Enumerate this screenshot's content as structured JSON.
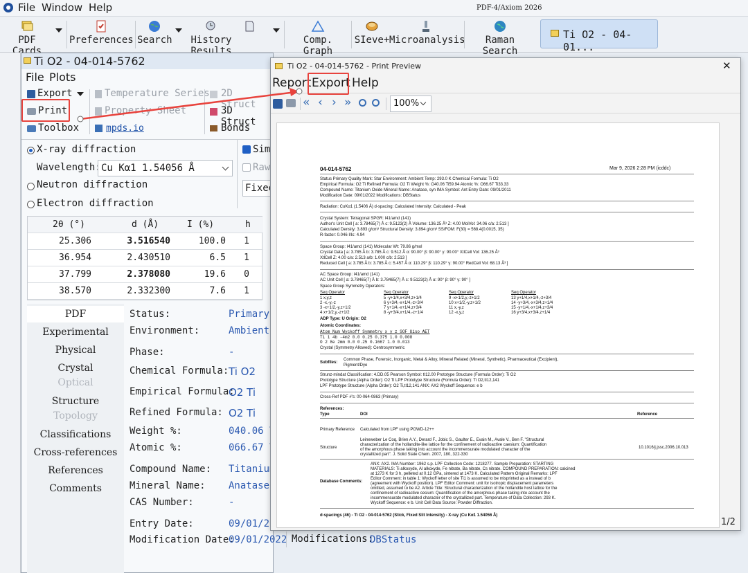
{
  "app": {
    "menu": [
      "File",
      "Window",
      "Help"
    ],
    "product_label": "PDF-4/Axiom 2026"
  },
  "toolbar": {
    "pdf_cards": "PDF Cards",
    "preferences": "Preferences",
    "search": "Search",
    "history_results": "History Results",
    "comp_graph": "Comp. Graph",
    "sieve": "SIeve+",
    "microanalysis": "Microanalysis",
    "raman_search": "Raman Search",
    "active_tab": "Ti O2 - 04-01..."
  },
  "card_window": {
    "title": "Ti O2 - 04-014-5762",
    "menu": [
      "File",
      "Plots"
    ],
    "tools": {
      "export": "Export",
      "print": "Print",
      "toolbox": "Toolbox",
      "temperature_series": "Temperature Series",
      "property_sheet": "Property Sheet",
      "mpds": "mpds.io",
      "structure_2d": "2D Struct",
      "structure_3d": "3D Struct",
      "bonds": "Bonds"
    },
    "diffraction": {
      "xray": "X-ray diffraction",
      "wavelength_label": "Wavelength:",
      "wavelength_value": "Cu Kα1 1.54056 Å",
      "neutron": "Neutron diffraction",
      "electron": "Electron diffraction",
      "sim_label": "Sim",
      "raw_label": "Raw",
      "fixed_label": "Fixed"
    },
    "peaks": {
      "headers": [
        "2θ (°)",
        "d (Å)",
        "I (%)",
        "h"
      ],
      "rows": [
        [
          "25.306",
          "3.516540",
          "100.0",
          "1"
        ],
        [
          "36.954",
          "2.430510",
          "6.5",
          "1"
        ],
        [
          "37.799",
          "2.378080",
          "19.6",
          "0"
        ],
        [
          "38.570",
          "2.332300",
          "7.6",
          "1"
        ]
      ]
    },
    "side_tabs": [
      "PDF",
      "Experimental",
      "Physical",
      "Crystal",
      "Optical",
      "Structure",
      "Topology",
      "Classifications",
      "Cross-references",
      "References",
      "Comments"
    ],
    "properties": [
      {
        "label": "Status:",
        "value": "Primary"
      },
      {
        "label": "Environment:",
        "value": "Ambient"
      },
      {
        "label": "Phase:",
        "value": "-"
      },
      {
        "label": "Chemical Formula:",
        "value": "Ti O2"
      },
      {
        "label": "Empirical Formula:",
        "value": "O2 Ti"
      },
      {
        "label": "Refined Formula:",
        "value": "O2 Ti"
      },
      {
        "label": "Weight %:",
        "value": "040.06 T"
      },
      {
        "label": "Atomic %:",
        "value": "066.67 T"
      },
      {
        "label": "Compound Name:",
        "value": "Titanium"
      },
      {
        "label": "Mineral Name:",
        "value": "Anatase,"
      },
      {
        "label": "CAS Number:",
        "value": "-"
      },
      {
        "label": "Entry Date:",
        "value": "09/01/20"
      },
      {
        "label": "Modification Date:",
        "value": "09/01/2022"
      }
    ],
    "modifications_label": "Modifications:",
    "modifications_value": "DBStatus"
  },
  "preview": {
    "title": "Ti O2 - 04-014-5762 - Print Preview",
    "menu": [
      "Report",
      "Export",
      "Help"
    ],
    "zoom": "100%",
    "page_indicator": "1/2"
  },
  "document": {
    "pdf_number": "04-014-5762",
    "date": "Mar 9, 2026 2:28 PM (icddc)",
    "header_lines": [
      "Status Primary    Quality Mark: Star    Environment: Ambient    Temp: 293.0 K    Chemical Formula: Ti O2",
      "Empirical Formula: O2 Ti    Refined Formula: O2 Ti    Weight %: O40.06 Ti59.94    Atomic %: O66.67 Ti33.33",
      "Compound Name: Titanium Oxide    Mineral Name: Anatase, syn    IMA Symbol: Ant    Entry Date: 09/01/2011",
      "Modification Date: 09/01/2022    Modifications: DBStatus"
    ],
    "radiation": "Radiation: CuKα1 (1.5406 Å)    d-spacing: Calculated    Intensity: Calculated - Peak",
    "crystal_lines": [
      "Crystal System: Tetragonal    SPGR: I41/amd (141)",
      "Author's Unit Cell [ a: 3.78465(7) Å    c: 9.5123(2) Å    Volume: 136.25 Å³    Z: 4.00    MolVol: 34.06    c/a: 2.513 ]",
      "Calculated Density: 3.893 g/cm³    Structural Density: 3.894 g/cm³    SS/FOM: F(30) = 568.4(0.0015, 35)",
      "R-factor: 0.046    I/Ic: 4.94"
    ],
    "space_group_lines": [
      "Space Group: I41/amd (141)    Molecular Wt: 79.86 g/mol",
      "Crystal Data [ a: 3.785 Å    b: 3.785 Å    c: 9.512 Å    α: 90.00°    β: 90.00°    γ: 90.00°    XtlCell Vol: 136.25 Å³",
      "XtlCell Z: 4.00    c/a: 2.513    a/b: 1.000    c/b: 2.513 ]",
      "Reduced Cell [ a: 3.785 Å    b: 3.785 Å    c: 5.457 Å    α: 110.29°    β: 110.29°    γ: 90.00°    RedCell Vol: 68.13 Å³ ]"
    ],
    "ac_lines": [
      "AC Space Group: I41/amd (141)",
      "AC Unit Cell [ a: 3.78465(7) Å    b: 3.78465(7) Å    c: 9.5123(2) Å    α: 90°    β: 90°    γ: 90° ]",
      "Space Group Symmetry Operators:"
    ],
    "sym_header": "Seq  Operator",
    "sym_ops": [
      [
        "1  x,y,z",
        "5  -y+1/4,x+3/4,z+1/4",
        "9  -x+1/2,y,-z+1/2",
        "13  y+1/4,x+1/4,-z+3/4"
      ],
      [
        "2  -x,-y,-z",
        "6  y+3/4,-x+1/4,-z+3/4",
        "10  x+1/2,-y,z+1/2",
        "14  -y+3/4,-x+3/4,z+1/4"
      ],
      [
        "3  -x+1/2,-y,z+1/2",
        "7  y+1/4,-x+1/4,z+3/4",
        "11  x,-y,z",
        "15  -y+1/4,-x+1/4,z+3/4"
      ],
      [
        "4  x+1/2,y,-z+1/2",
        "8  -y+3/4,x+1/4,-z+1/4",
        "12  -x,y,z",
        "16  y+3/4,x+3/4,z+1/4"
      ]
    ],
    "adp": "ADP Type: U    Origin: O2",
    "atomic_header": "Atomic Coordinates:",
    "atom_cols": "Atom   Num   Wyckoff   Symmetry   x     y     z      SOF   Uiso   AET",
    "atom_rows": [
      "Ti     1     4b        -4m2       0.0   0.25  0.375  1.0   0.008",
      "O      2     8e        2mm        0.0   0.25  0.1667 1.0   0.013"
    ],
    "crystal_sym": "Crystal (Symmetry Allowed): Centrosymmetric",
    "subfiles_label": "Subfiles:",
    "subfiles_lines": [
      "Common Phase, Forensic, Inorganic, Metal & Alloy, Mineral Related (Mineral, Synthetic), Pharmaceutical (Excipient),",
      "Pigment/Dye"
    ],
    "strunz_lines": [
      "Strunz-mindat Classification: 4.DD.05    Pearson Symbol: tI12.00    Prototype Structure (Formula Order): Ti O2",
      "Prototype Structure (Alpha Order): O2 Ti    LPF Prototype Structure (Formula Order): Ti O2,tI12,141",
      "LPF Prototype Structure (Alpha Order): O2 Ti,tI12,141    ANX: AX2    Wyckoff Sequence: e b"
    ],
    "crossref": "Cross-Ref PDF #'s: 00-064-0863 (Primary)",
    "refs_header": "References:",
    "refs_cols": [
      "Type",
      "DOI",
      "Reference"
    ],
    "ref_primary": [
      "Primary Reference",
      "Calculated from LPF using POWD-12++"
    ],
    "ref_structure_label": "Structure",
    "ref_structure_lines": [
      "Leineweber Le Coq, Brien A.Y., Derard F., Jobic S., Gaulter E., Evain M., Avale V., Ben F. \"Structural",
      "characterization of the hollandite-like lattice for the confinement of radioactive caesium: Quantification",
      "of the amorphous phase taking into account the incommensurate modulated character of the",
      "crystallized part\". J. Solid State Chem. 2007, 180, 322-330"
    ],
    "ref_structure_doi": "10.1016/j.jssc.2006.10.013",
    "dbcomments_label": "Database Comments:",
    "dbcomments_lines": [
      "ANX: AX2. IMA Number: 1962 s.p. LPF Collection Code: 1218277. Sample Preparation: STARTING",
      "MATERIALS: Ti alkoxyde, Al alkoxyde, Fe nitrate, Ba nitrate, Cs nitrate. COMPOUND PREPARATION: calcined",
      "at 1273 K for 3 h, pelleted at 0.12 GPa, sintered at 1473 K. Calculated Pattern Original Remarks: LPF",
      "Editor Comment: in table 1: Wyckoff letter of site Ti1 is assumed to be misprinted as a instead of b",
      "(agreement with Wyckoff position). LPF Editor Comment: unit for isotropic displacement parameters",
      "omitted, assumed to be A2. Article Title: Structural characterization of the hollandite host lattice for the",
      "confinement of radioactive cesium: Quantification of the amorphous phase taking into account the",
      "incommensurate modulated character of the crystallized part. Temperature of Data Collection: 293 K.",
      "Wyckoff Sequence: e b. Unit Cell Data Source: Powder Diffraction."
    ],
    "footer": "d-spacings (46) - Ti O2 - 04-014-5762 (Stick, Fixed Slit Intensity) - X-ray (Cu Kα1 1.54056 Å)"
  },
  "colors": {
    "highlight": "#e8433d",
    "link_blue": "#2a58b0",
    "active_tab_bg": "#cfe0f5"
  }
}
